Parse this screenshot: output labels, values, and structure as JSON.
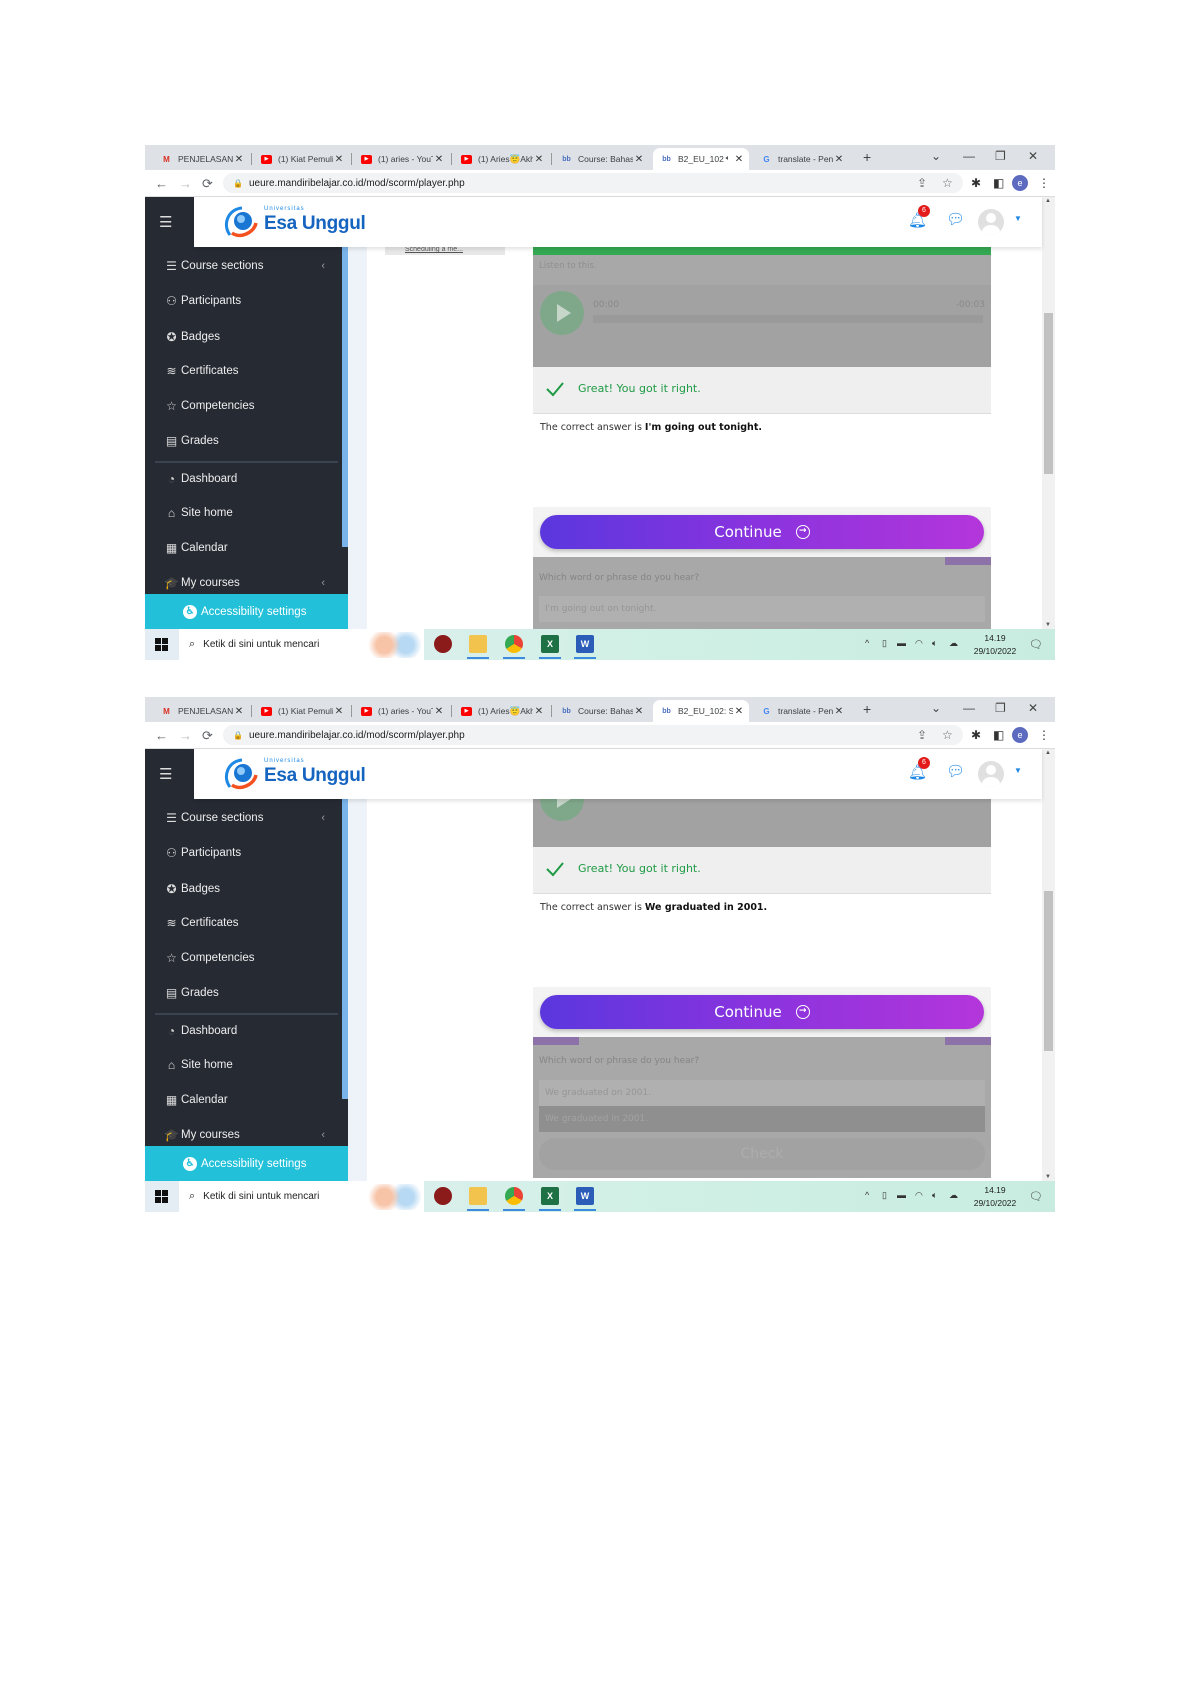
{
  "browser": {
    "url": "ueure.mandiribelajar.co.id/mod/scorm/player.php",
    "new_tab": "+",
    "profile_initial": "e"
  },
  "site": {
    "logo_small": "Universitas",
    "logo_name": "Esa Unggul",
    "notification_count": "6"
  },
  "sidebar": {
    "items": [
      {
        "label": "Course sections",
        "icon": "list-icon",
        "glyph": "☰",
        "chevron": true
      },
      {
        "label": "Participants",
        "icon": "users-icon",
        "glyph": "⚇"
      },
      {
        "label": "Badges",
        "icon": "badge-icon",
        "glyph": "✪"
      },
      {
        "label": "Certificates",
        "icon": "layers-icon",
        "glyph": "≋"
      },
      {
        "label": "Competencies",
        "icon": "star-icon",
        "glyph": "☆"
      },
      {
        "label": "Grades",
        "icon": "book-icon",
        "glyph": "▤"
      },
      {
        "label": "Dashboard",
        "icon": "gauge-icon",
        "glyph": "◔"
      },
      {
        "label": "Site home",
        "icon": "home-icon",
        "glyph": "⌂"
      },
      {
        "label": "Calendar",
        "icon": "calendar-icon",
        "glyph": "▦"
      },
      {
        "label": "My courses",
        "icon": "graduation-cap-icon",
        "glyph": "🎓",
        "chevron": true
      }
    ],
    "accessibility": "Accessibility settings"
  },
  "taskbar": {
    "search_placeholder": "Ketik di sini untuk mencari",
    "time": "14.19",
    "date": "29/10/2022"
  },
  "shots": [
    {
      "tabs": [
        {
          "label": "PENJELASAN U",
          "icon": "gmail"
        },
        {
          "label": "(1) Kiat Pemulih",
          "icon": "youtube"
        },
        {
          "label": "(1) aries - YouT",
          "icon": "youtube"
        },
        {
          "label": "(1) Aries😇Akh",
          "icon": "youtube"
        },
        {
          "label": "Course: Bahasa",
          "icon": "bb"
        },
        {
          "label": "B2_EU_102",
          "icon": "bb",
          "active": true,
          "audio": true
        },
        {
          "label": "translate - Pen",
          "icon": "google"
        }
      ],
      "content": {
        "scheduling_link": "Scheduling a me...",
        "listen_label": "Listen to this.",
        "time_elapsed": "00:00",
        "time_remaining": "-00:03",
        "feedback": "Great! You got it right.",
        "answer_prefix": "The correct answer is ",
        "answer": "I'm going out tonight.",
        "continue": "Continue",
        "question": "Which word or phrase do you hear?",
        "options": [
          "I'm going out on tonight."
        ]
      }
    },
    {
      "tabs": [
        {
          "label": "PENJELASAN U",
          "icon": "gmail"
        },
        {
          "label": "(1) Kiat Pemulih",
          "icon": "youtube"
        },
        {
          "label": "(1) aries - YouT",
          "icon": "youtube"
        },
        {
          "label": "(1) Aries😇Akh",
          "icon": "youtube"
        },
        {
          "label": "Course: Bahasa",
          "icon": "bb"
        },
        {
          "label": "B2_EU_102: Se",
          "icon": "bb",
          "active": true
        },
        {
          "label": "translate - Pen",
          "icon": "google"
        }
      ],
      "content": {
        "feedback": "Great! You got it right.",
        "answer_prefix": "The correct answer is ",
        "answer": "We graduated in 2001.",
        "continue": "Continue",
        "question": "Which word or phrase do you hear?",
        "options": [
          "We graduated on 2001.",
          "We graduated in 2001."
        ],
        "selected_option": 1,
        "check": "Check"
      }
    }
  ]
}
